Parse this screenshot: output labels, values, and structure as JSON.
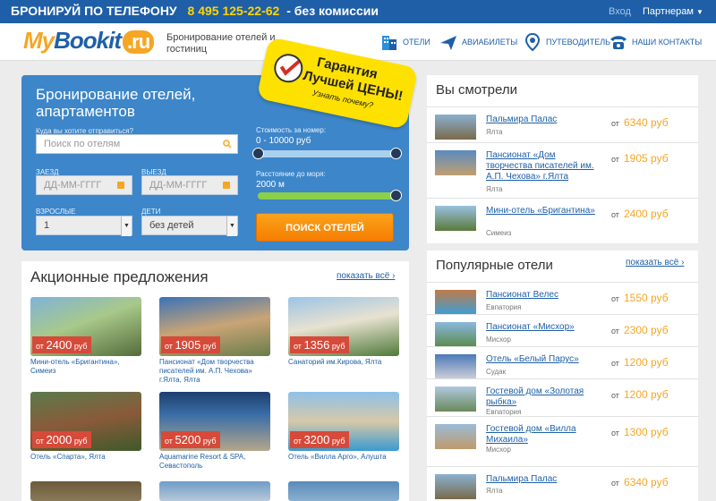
{
  "topbar": {
    "promo_prefix": "БРОНИРУЙ ПО ТЕЛЕФОНУ",
    "phone": "8 495 125-22-62",
    "promo_suffix": "- без комиссии",
    "login": "Вход",
    "partners": "Партнерам"
  },
  "header": {
    "logo_my": "My",
    "logo_bookit": "Bookit",
    "logo_ru": ".ru",
    "tagline": "Бронирование отелей и гостиниц",
    "nav": {
      "hotels": "ОТЕЛИ",
      "flights": "АВИАБИЛЕТЫ",
      "guide": "ПУТЕВОДИТЕЛЬ",
      "contacts": "НАШИ КОНТАКТЫ"
    }
  },
  "search": {
    "title": "Бронирование отелей, апартаментов",
    "where_label": "Куда вы хотите отправиться?",
    "where_placeholder": "Поиск по отелям",
    "checkin_label": "ЗАЕЗД",
    "checkin_placeholder": "ДД-ММ-ГГГГ",
    "checkout_label": "ВЫЕЗД",
    "checkout_placeholder": "ДД-ММ-ГГГГ",
    "adults_label": "ВЗРОСЛЫЕ",
    "adults_value": "1",
    "children_label": "ДЕТИ",
    "children_value": "без детей",
    "price_label": "Стоимость за номер:",
    "price_value": "0 - 10000 руб",
    "price_range": [
      0,
      10000
    ],
    "sea_label": "Расстояние до моря:",
    "sea_value": "2000 м",
    "sea_fill": 1.0,
    "button": "ПОИСК ОТЕЛЕЙ"
  },
  "guarantee": {
    "line1": "Гарантия",
    "line2": "Лучшей ЦЕНЫ!",
    "line3": "Узнать почему?"
  },
  "promos": {
    "title": "Акционные предложения",
    "show_all": "показать всё",
    "price_prefix": "от",
    "currency": "руб",
    "cards": [
      {
        "price": "2400",
        "name": "Мини-отель «Бригантина», Симеиз"
      },
      {
        "price": "1905",
        "name": "Пансионат «Дом творчества писателей им. А.П. Чехова» г.Ялта, Ялта"
      },
      {
        "price": "1356",
        "name": "Санаторий им.Кирова, Ялта"
      },
      {
        "price": "2000",
        "name": "Отель «Спарта», Ялта"
      },
      {
        "price": "5200",
        "name": "Aquamarine Resort & SPA, Севастополь"
      },
      {
        "price": "3200",
        "name": "Отель «Вилла Арго», Алушта"
      }
    ]
  },
  "viewed": {
    "title": "Вы смотрели",
    "price_prefix": "от",
    "items": [
      {
        "name": "Пальмира Палас",
        "city": "Ялта",
        "price": "6340 руб"
      },
      {
        "name": "Пансионат «Дом творчества писателей им. А.П. Чехова» г.Ялта",
        "city": "Ялта",
        "price": "1905 руб"
      },
      {
        "name": "Мини-отель «Бригантина»",
        "city": "Симеиз",
        "price": "2400 руб"
      }
    ]
  },
  "popular": {
    "title": "Популярные отели",
    "show_all": "показать всё",
    "price_prefix": "от",
    "items": [
      {
        "name": "Пансионат Велес",
        "city": "Евпатория",
        "price": "1550 руб"
      },
      {
        "name": "Пансионат «Мисхор»",
        "city": "Мисхор",
        "price": "2300 руб"
      },
      {
        "name": "Отель «Белый Парус»",
        "city": "Судак",
        "price": "1200 руб"
      },
      {
        "name": "Гостевой дом «Золотая рыбка»",
        "city": "Евпатория",
        "price": "1200 руб"
      },
      {
        "name": "Гостевой дом «Вилла Михаила»",
        "city": "Мисхор",
        "price": "1300 руб"
      },
      {
        "name": "Пальмира Палас",
        "city": "Ялта",
        "price": "6340 руб"
      }
    ]
  },
  "colors": {
    "brand_blue": "#1e5fa8",
    "accent_orange": "#f5a623",
    "panel_blue": "#3d86c9",
    "price_red": "#d64a3a"
  }
}
